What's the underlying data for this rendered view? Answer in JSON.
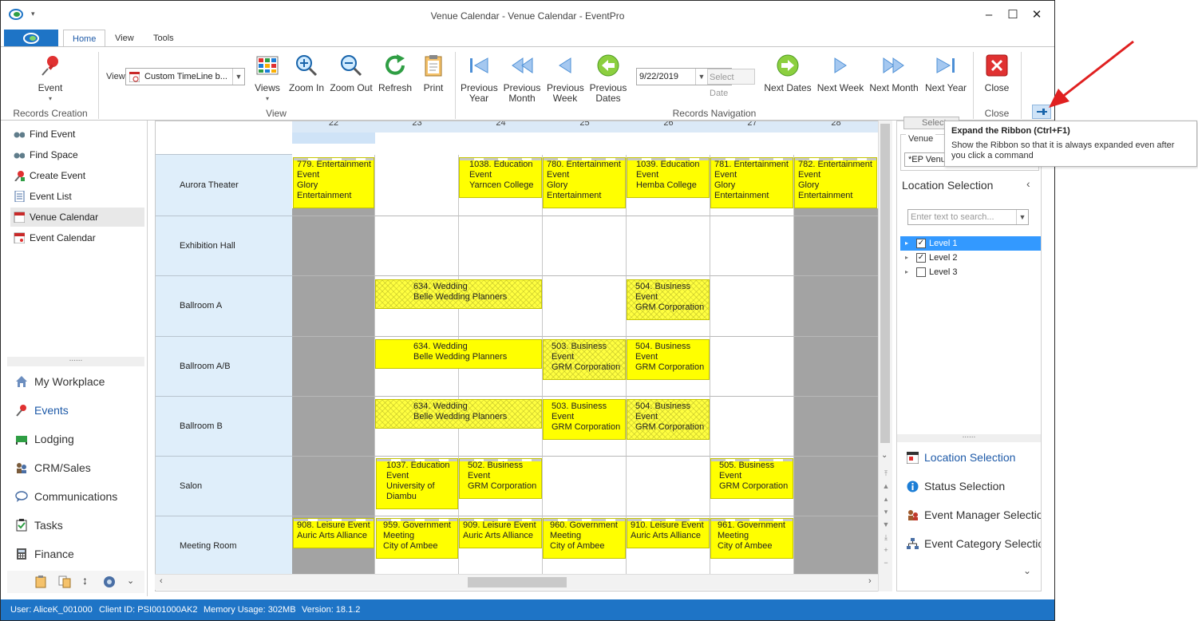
{
  "window": {
    "title": "Venue Calendar - Venue Calendar - EventPro"
  },
  "ribbon_tabs": [
    "Home",
    "View",
    "Tools"
  ],
  "ribbon": {
    "event_button": "Event",
    "records_creation_label": "Records Creation",
    "view_label": "View",
    "view_combo_value": "Custom TimeLine b...",
    "views_button": "Views",
    "zoom_in": "Zoom In",
    "zoom_out": "Zoom Out",
    "refresh": "Refresh",
    "print": "Print",
    "view_group_label": "View",
    "prev_year": "Previous Year",
    "prev_month": "Previous Month",
    "prev_week": "Previous Week",
    "prev_dates": "Previous Dates",
    "date_value": "9/22/2019",
    "select_date": "Select Date",
    "next_dates": "Next Dates",
    "next_week": "Next Week",
    "next_month": "Next Month",
    "next_year": "Next Year",
    "records_nav_label": "Records Navigation",
    "close_button": "Close",
    "close_group_label": "Close"
  },
  "tooltip": {
    "title": "Expand the Ribbon (Ctrl+F1)",
    "description": "Show the Ribbon so that it is always expanded even after you click a command"
  },
  "nav_links": [
    "Find Event",
    "Find Space",
    "Create Event",
    "Event List",
    "Venue Calendar",
    "Event Calendar"
  ],
  "nav_modules": [
    "My Workplace",
    "Events",
    "Lodging",
    "CRM/Sales",
    "Communications",
    "Tasks",
    "Finance"
  ],
  "splitter_dots": "......",
  "calendar": {
    "days": [
      "22",
      "23",
      "24",
      "25",
      "26",
      "27",
      "28"
    ],
    "rows": [
      "Aurora Theater",
      "Exhibition Hall",
      "Ballroom A",
      "Ballroom A/B",
      "Ballroom B",
      "Salon",
      "Meeting Room"
    ],
    "events": [
      {
        "lines": [
          "779. Entertainment",
          "Event",
          "Glory",
          "Entertainment"
        ]
      },
      {
        "lines": [
          "1038. Education",
          "Event",
          "Yarncen College"
        ]
      },
      {
        "lines": [
          "780. Entertainment",
          "Event",
          "Glory",
          "Entertainment"
        ]
      },
      {
        "lines": [
          "1039. Education",
          "Event",
          "Hemba College"
        ]
      },
      {
        "lines": [
          "781. Entertainment",
          "Event",
          "Glory",
          "Entertainment"
        ]
      },
      {
        "lines": [
          "782. Entertainment",
          "Event",
          "Glory",
          "Entertainment"
        ]
      },
      {
        "lines": [
          "634. Wedding",
          "Belle Wedding Planners"
        ]
      },
      {
        "lines": [
          "504. Business",
          "Event",
          "GRM Corporation"
        ]
      },
      {
        "lines": [
          "634. Wedding",
          "Belle Wedding Planners"
        ]
      },
      {
        "lines": [
          "503. Business",
          "Event",
          "GRM Corporation"
        ]
      },
      {
        "lines": [
          "504. Business",
          "Event",
          "GRM Corporation"
        ]
      },
      {
        "lines": [
          "634. Wedding",
          "Belle Wedding Planners"
        ]
      },
      {
        "lines": [
          "503. Business",
          "Event",
          "GRM Corporation"
        ]
      },
      {
        "lines": [
          "504. Business",
          "Event",
          "GRM Corporation"
        ]
      },
      {
        "lines": [
          "1037. Education",
          "Event",
          "University of",
          "Diambu"
        ]
      },
      {
        "lines": [
          "502. Business",
          "Event",
          "GRM Corporation"
        ]
      },
      {
        "lines": [
          "505. Business",
          "Event",
          "GRM Corporation"
        ]
      },
      {
        "lines": [
          "908. Leisure Event",
          "Auric Arts Alliance"
        ]
      },
      {
        "lines": [
          "959. Government",
          "Meeting",
          "City of Ambee"
        ]
      },
      {
        "lines": [
          "909. Leisure Event",
          "Auric Arts Alliance"
        ]
      },
      {
        "lines": [
          "960. Government",
          "Meeting",
          "City of Ambee"
        ]
      },
      {
        "lines": [
          "910. Leisure Event",
          "Auric Arts Alliance"
        ]
      },
      {
        "lines": [
          "961. Government",
          "Meeting",
          "City of Ambee"
        ]
      }
    ]
  },
  "right_panel": {
    "select_button": "Select",
    "venue_label": "Venue",
    "venue_value": "*EP Venue",
    "location_selection_title": "Location Selection",
    "search_placeholder": "Enter text to search...",
    "tree": [
      "Level 1",
      "Level 2",
      "Level 3"
    ],
    "panel_links": [
      "Location Selection",
      "Status Selection",
      "Event Manager Selectio",
      "Event Category Selectio"
    ]
  },
  "status_bar": {
    "user": "User: AliceK_001000",
    "client": "Client ID: PSI001000AK2",
    "memory": "Memory Usage: 302MB",
    "version": "Version: 18.1.2"
  },
  "colors": {
    "accent": "#1e74c6",
    "event_yellow": "#ffff00",
    "unavailable_gray": "#a3a3a3",
    "row_header_blue": "#dfeefa",
    "selection_blue": "#3399ff",
    "arrow_red": "#e02020"
  }
}
